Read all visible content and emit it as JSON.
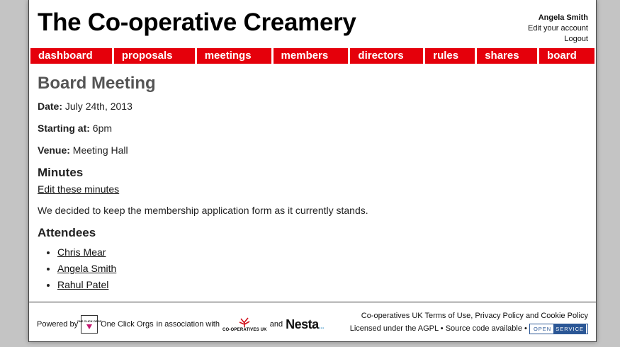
{
  "header": {
    "site_title": "The Co-operative Creamery",
    "user_name": "Angela Smith",
    "edit_account": "Edit your account",
    "logout": "Logout"
  },
  "nav": {
    "items": [
      {
        "label": "dashboard"
      },
      {
        "label": "proposals"
      },
      {
        "label": "meetings"
      },
      {
        "label": "members"
      },
      {
        "label": "directors"
      },
      {
        "label": "rules"
      },
      {
        "label": "shares"
      },
      {
        "label": "board"
      }
    ]
  },
  "meeting": {
    "title": "Board Meeting",
    "date_label": "Date:",
    "date_value": "July 24th, 2013",
    "start_label": "Starting at:",
    "start_value": "6pm",
    "venue_label": "Venue:",
    "venue_value": "Meeting Hall",
    "minutes_heading": "Minutes",
    "edit_minutes": "Edit these minutes",
    "minutes_text": "We decided to keep the membership application form as it currently stands.",
    "attendees_heading": "Attendees",
    "attendees": [
      "Chris Mear",
      "Angela Smith",
      "Rahul Patel"
    ]
  },
  "footer": {
    "powered_by": "Powered by",
    "oco_logo_text": "ONE CLICK ORGS",
    "oco_name": "One Click Orgs",
    "in_association": "in association with",
    "coop_logo_text": "CO-OPERATIVES UK",
    "and": "and",
    "nesta": "Nesta",
    "legal_prefix": "Co-operatives UK",
    "terms": "Terms of Use",
    "privacy": "Privacy Policy",
    "and_word": "and",
    "cookie": "Cookie Policy",
    "licensed": "Licensed under the AGPL",
    "bullet": "•",
    "source": "Source code available",
    "open_a": "OPEN",
    "open_b": "SERVICE"
  },
  "colors": {
    "nav_red": "#e5000b",
    "title_grey": "#555555",
    "background": "#c4c4c4",
    "badge_blue": "#2b5796",
    "oco_pink": "#c21970"
  }
}
